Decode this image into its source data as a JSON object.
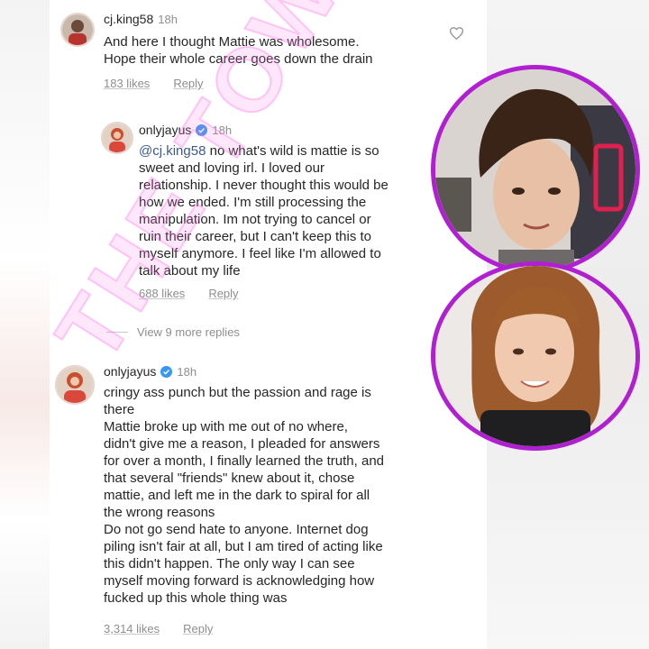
{
  "watermark": "THE TOWN",
  "comments": [
    {
      "username": "cj.king58",
      "time": "18h",
      "text": "And here I thought Mattie was wholesome.\nHope their whole career goes down the drain",
      "likes": "183 likes",
      "reply": "Reply"
    },
    {
      "username": "onlyjayus",
      "time": "18h",
      "mention": "@cj.king58",
      "text": " no what's wild is mattie is so\nsweet and loving irl. I loved our\nrelationship. I never thought this would be\nhow we ended. I'm still processing the\nmanipulation. Im not trying to cancel or\nruin their career, but I can't keep this to\nmyself anymore. I feel like I'm allowed to\ntalk about my life",
      "likes": "688 likes",
      "reply": "Reply"
    },
    {
      "username": "onlyjayus",
      "time": "18h",
      "text": "cringy ass punch but the passion and rage is\nthere\nMattie broke up with me out of no where,\ndidn't give me a reason, I pleaded for answers\nfor over a month, I finally learned the truth, and\nthat several \"friends\" knew about it, chose\nmattie, and left me in the dark to spiral for all\nthe wrong reasons\nDo not go send hate to anyone. Internet dog\npiling isn't fair at all, but I am tired of acting like\nthis didn't happen. The only way I can see\nmyself moving forward is acknowledging how\nfucked up this whole thing was",
      "likes": "3,314 likes",
      "reply": "Reply"
    }
  ],
  "view_more": "View 9 more replies",
  "colors": {
    "ring": "#b01fd0",
    "verified": "#3897f0",
    "meta": "#8e8e8e"
  }
}
